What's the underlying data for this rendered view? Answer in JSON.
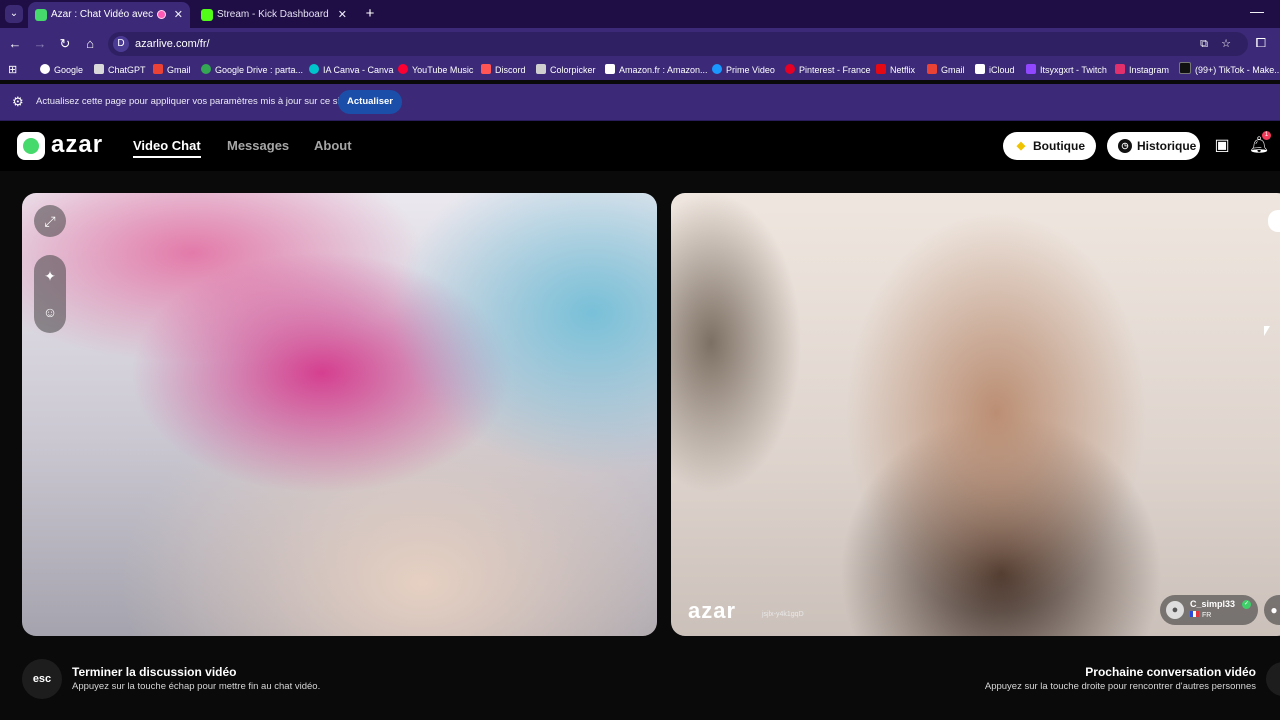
{
  "browser": {
    "tabs": [
      {
        "label": "Azar : Chat Vidéo avec de n",
        "active": true,
        "favicon_color": "#46d96c",
        "close_label": "✕"
      },
      {
        "label": "Stream - Kick Dashboard",
        "active": false,
        "favicon_color": "#53fc18",
        "close_label": "✕"
      }
    ],
    "tab_menu_icon": "chevron-down-icon",
    "new_tab_label": "+",
    "minimize_label": "—",
    "url": "azarlive.com/fr/",
    "bookmarks": [
      {
        "label": "Google",
        "icon_color": "#ffffff"
      },
      {
        "label": "ChatGPT",
        "icon_color": "#d9d9d9"
      },
      {
        "label": "Gmail",
        "icon_color": "#ea4335"
      },
      {
        "label": "Google Drive : parta...",
        "icon_color": "#34a853"
      },
      {
        "label": "IA Canva - Canva",
        "icon_color": "#00c4cc"
      },
      {
        "label": "YouTube Music",
        "icon_color": "#ff0033"
      },
      {
        "label": "Discord",
        "icon_color": "#ff5555"
      },
      {
        "label": "Colorpicker",
        "icon_color": "#cfcfcf"
      },
      {
        "label": "Amazon.fr : Amazon...",
        "icon_color": "#ffffff"
      },
      {
        "label": "Prime Video",
        "icon_color": "#1a98ff"
      },
      {
        "label": "Pinterest - France",
        "icon_color": "#e60023"
      },
      {
        "label": "Netflix",
        "icon_color": "#e50914"
      },
      {
        "label": "Gmail",
        "icon_color": "#ea4335"
      },
      {
        "label": "iCloud",
        "icon_color": "#ffffff"
      },
      {
        "label": "Itsyxgxrt - Twitch",
        "icon_color": "#9146ff"
      },
      {
        "label": "Instagram",
        "icon_color": "#e1306c"
      },
      {
        "label": "(99+) TikTok - Make...",
        "icon_color": "#111111"
      }
    ],
    "infobar": {
      "message": "Actualisez cette page pour appliquer vos paramètres mis à jour sur ce site",
      "button_label": "Actualiser"
    }
  },
  "app": {
    "logo_text": "azar",
    "nav": [
      {
        "label": "Video Chat",
        "active": true
      },
      {
        "label": "Messages",
        "active": false
      },
      {
        "label": "About",
        "active": false
      }
    ],
    "boutique_label": "Boutique",
    "historique_label": "Historique",
    "notification_count": "1",
    "watermark_logo": "azar",
    "watermark_id": "jsjlx-y4k1gqD",
    "peer": {
      "name": "C_simpl33",
      "country": "FR"
    },
    "footer_left": {
      "key_label": "esc",
      "title": "Terminer la discussion vidéo",
      "subtitle": "Appuyez sur la touche échap pour mettre fin au chat vidéo."
    },
    "footer_right": {
      "title": "Prochaine conversation vidéo",
      "subtitle": "Appuyez sur la touche droite pour rencontrer d'autres personnes"
    }
  },
  "colors": {
    "browser_chrome": "#3c2a78",
    "tab_strip": "#1f0d45",
    "infobar_button": "#1a4ea8",
    "azar_green": "#46d96c",
    "page_background": "#0a0a0a"
  }
}
